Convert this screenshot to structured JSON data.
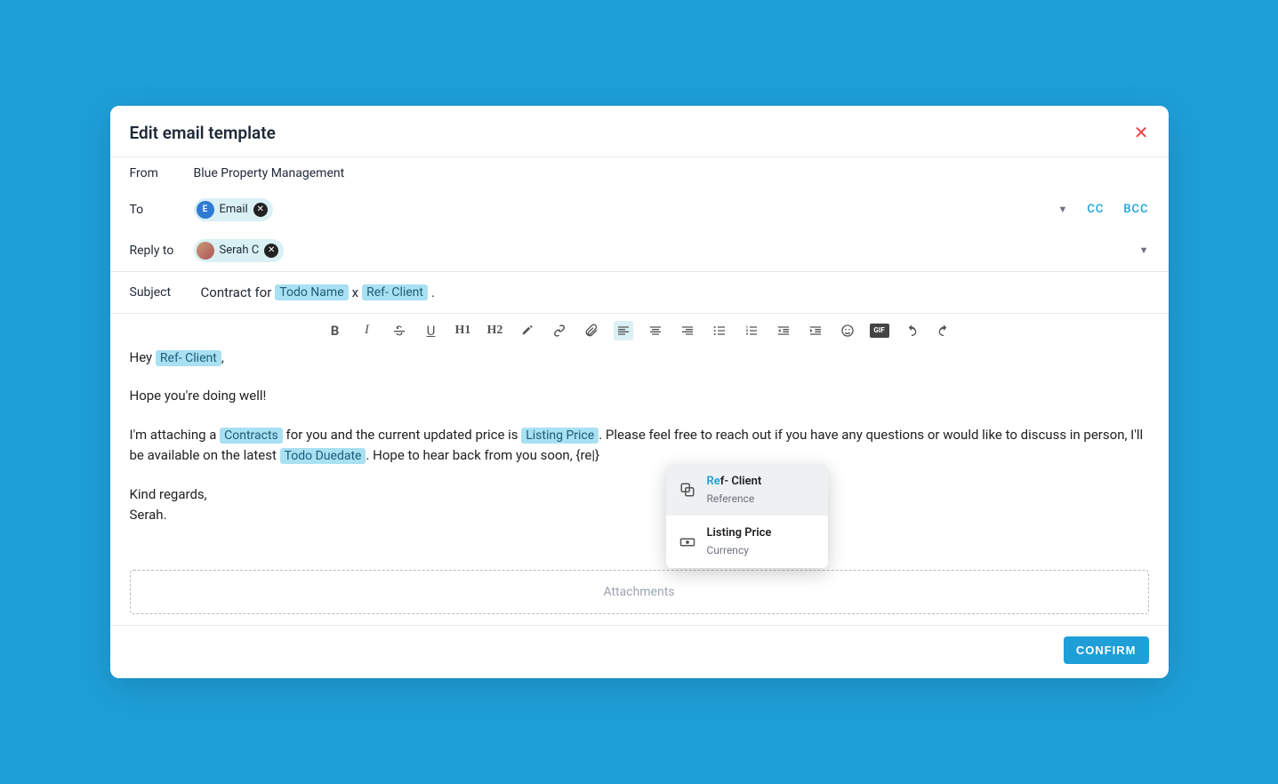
{
  "modal": {
    "title": "Edit email template",
    "confirm_label": "CONFIRM"
  },
  "fields": {
    "from_label": "From",
    "from_value": "Blue Property Management",
    "to_label": "To",
    "to_chip": {
      "avatar": "E",
      "text": "Email"
    },
    "cc_label": "CC",
    "bcc_label": "BCC",
    "reply_label": "Reply to",
    "reply_chip": {
      "text": "Serah C"
    },
    "subject_label": "Subject",
    "subject": {
      "prefix": "Contract for ",
      "token1": "Todo Name",
      "mid": " x ",
      "token2": "Ref- Client",
      "suffix": "."
    }
  },
  "toolbar": {
    "bold": "B",
    "h1": "H1",
    "h2": "H2",
    "gif": "GIF"
  },
  "body": {
    "greeting_prefix": "Hey ",
    "greeting_token": "Ref- Client",
    "greeting_suffix": ",",
    "line2": "Hope you're doing well!",
    "p3_a": "I'm attaching a ",
    "p3_tok1": "Contracts",
    "p3_b": " for you and the current updated price is ",
    "p3_tok2": "Listing Price",
    "p3_c": ". Please feel free to reach out if you have any questions or would like to discuss in person, I'll be available on the latest ",
    "p3_tok3": "Todo Duedate",
    "p3_d": ". Hope to hear back from you soon, {re|}",
    "sign1": "Kind regards,",
    "sign2": "Serah."
  },
  "autocomplete": {
    "item1": {
      "match": "Re",
      "rest": "f- Client",
      "sub": "Reference"
    },
    "item2": {
      "title": "Listing Price",
      "sub": "Currency"
    }
  },
  "attachments_label": "Attachments"
}
